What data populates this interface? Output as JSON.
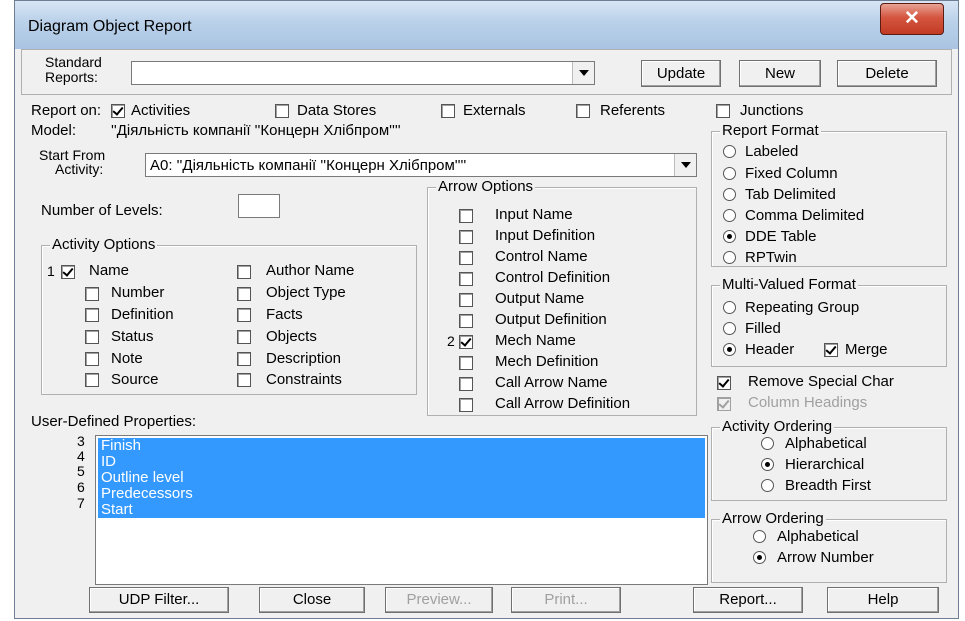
{
  "window": {
    "title": "Diagram Object Report",
    "close_glyph": "✕"
  },
  "standard_reports": {
    "label_line1": "Standard",
    "label_line2": "Reports:",
    "value": ""
  },
  "top_buttons": {
    "update": "Update",
    "new": "New",
    "delete": "Delete"
  },
  "report_on": {
    "label": "Report on:",
    "items": [
      {
        "label": "Activities",
        "checked": true
      },
      {
        "label": "Data Stores",
        "checked": false
      },
      {
        "label": "Externals",
        "checked": false
      },
      {
        "label": "Referents",
        "checked": false
      },
      {
        "label": "Junctions",
        "checked": false
      }
    ]
  },
  "model": {
    "label": "Model:",
    "value": "''Діяльність компанії ''Концерн Хлібпром'''' "
  },
  "start_from": {
    "label_line1": "Start From",
    "label_line2": "Activity:",
    "value": "A0:  ''Діяльність компанії  ''Концерн Хлібпром'''' "
  },
  "number_of_levels": {
    "label": "Number of Levels:",
    "value": ""
  },
  "activity_options": {
    "title": "Activity Options",
    "marker": "1",
    "col1": [
      {
        "label": "Name",
        "checked": true
      },
      {
        "label": "Number",
        "checked": false
      },
      {
        "label": "Definition",
        "checked": false
      },
      {
        "label": "Status",
        "checked": false
      },
      {
        "label": "Note",
        "checked": false
      },
      {
        "label": "Source",
        "checked": false
      }
    ],
    "col2": [
      {
        "label": "Author Name",
        "checked": false
      },
      {
        "label": "Object Type",
        "checked": false
      },
      {
        "label": "Facts",
        "checked": false
      },
      {
        "label": "Objects",
        "checked": false
      },
      {
        "label": "Description",
        "checked": false
      },
      {
        "label": "Constraints",
        "checked": false
      }
    ]
  },
  "arrow_options": {
    "title": "Arrow Options",
    "marker": "2",
    "items": [
      {
        "label": "Input Name",
        "checked": false
      },
      {
        "label": "Input Definition",
        "checked": false
      },
      {
        "label": "Control Name",
        "checked": false
      },
      {
        "label": "Control Definition",
        "checked": false
      },
      {
        "label": "Output Name",
        "checked": false
      },
      {
        "label": "Output Definition",
        "checked": false
      },
      {
        "label": "Mech Name",
        "checked": true
      },
      {
        "label": "Mech Definition",
        "checked": false
      },
      {
        "label": "Call Arrow Name",
        "checked": false
      },
      {
        "label": "Call Arrow Definition",
        "checked": false
      }
    ]
  },
  "report_format": {
    "title": "Report Format",
    "items": [
      {
        "label": "Labeled",
        "selected": false
      },
      {
        "label": "Fixed Column",
        "selected": false
      },
      {
        "label": "Tab Delimited",
        "selected": false
      },
      {
        "label": "Comma Delimited",
        "selected": false
      },
      {
        "label": "DDE Table",
        "selected": true
      },
      {
        "label": "RPTwin",
        "selected": false
      }
    ]
  },
  "multi_valued_format": {
    "title": "Multi-Valued Format",
    "items": [
      {
        "label": "Repeating Group",
        "selected": false
      },
      {
        "label": "Filled",
        "selected": false
      },
      {
        "label": "Header",
        "selected": true
      }
    ],
    "merge": {
      "label": "Merge",
      "checked": true
    }
  },
  "remove_special_char": {
    "label": "Remove Special Char",
    "checked": true
  },
  "column_headings": {
    "label": "Column Headings",
    "checked": true,
    "disabled": true
  },
  "activity_ordering": {
    "title": "Activity Ordering",
    "items": [
      {
        "label": "Alphabetical",
        "selected": false
      },
      {
        "label": "Hierarchical",
        "selected": true
      },
      {
        "label": "Breadth First",
        "selected": false
      }
    ]
  },
  "arrow_ordering": {
    "title": "Arrow Ordering",
    "items": [
      {
        "label": "Alphabetical",
        "selected": false
      },
      {
        "label": "Arrow Number",
        "selected": true
      }
    ]
  },
  "udp": {
    "label": "User-Defined Properties:",
    "items": [
      {
        "marker": "3",
        "label": "Finish"
      },
      {
        "marker": "4",
        "label": "ID"
      },
      {
        "marker": "5",
        "label": "Outline level"
      },
      {
        "marker": "6",
        "label": "Predecessors"
      },
      {
        "marker": "7",
        "label": "Start"
      }
    ]
  },
  "bottom_buttons": {
    "udp_filter": "UDP Filter...",
    "close": "Close",
    "preview": "Preview...",
    "print": "Print...",
    "report": "Report...",
    "help": "Help"
  }
}
